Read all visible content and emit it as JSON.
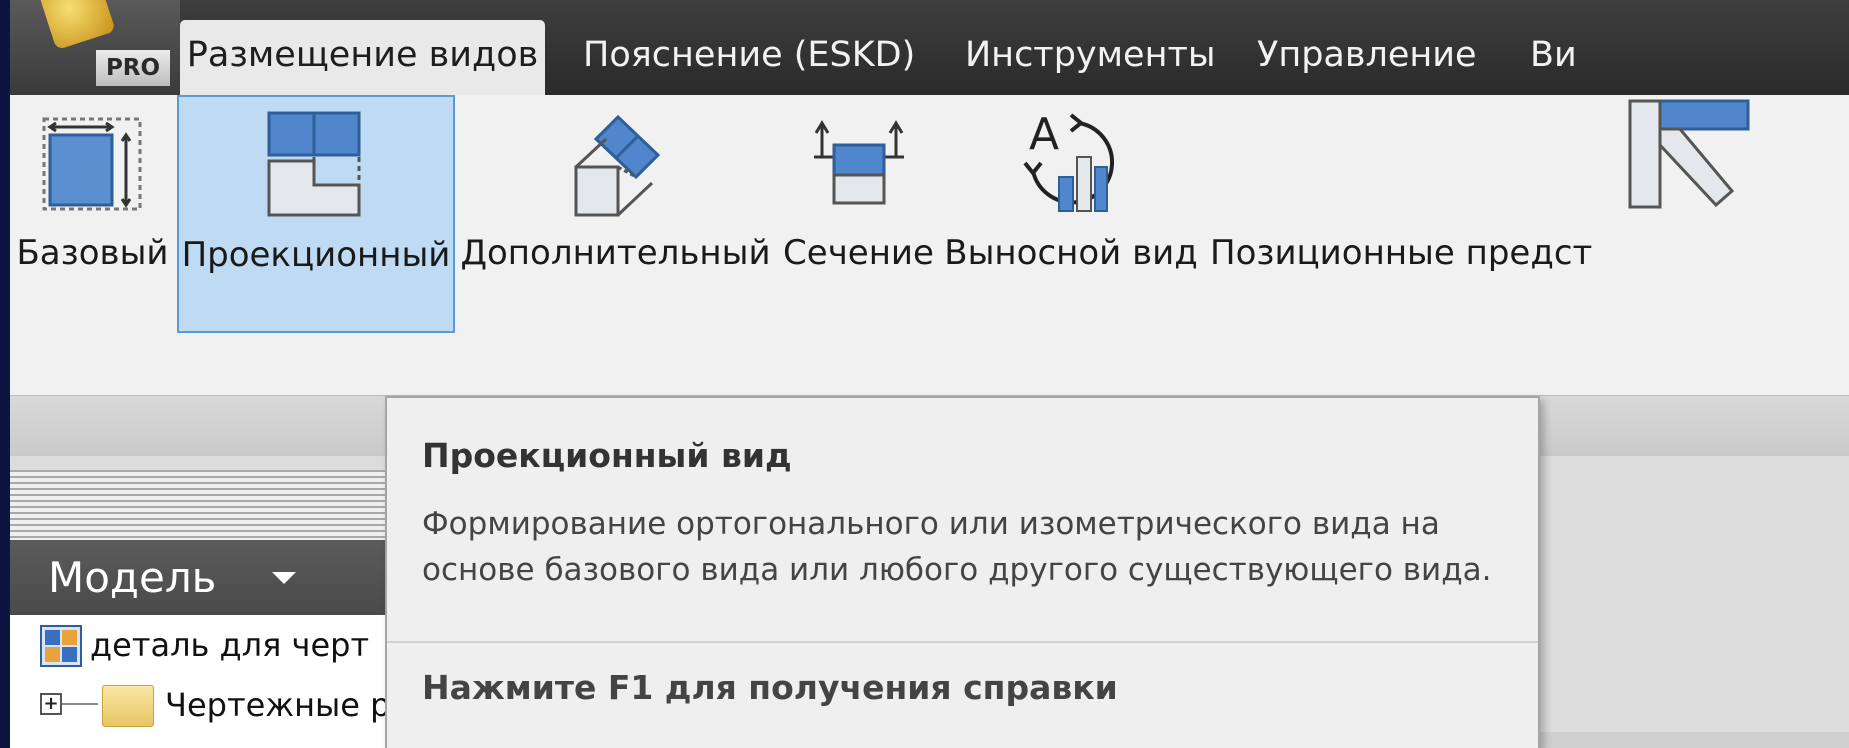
{
  "app_button": {
    "badge": "PRO"
  },
  "tabs": [
    {
      "label": "Размещение видов",
      "active": true
    },
    {
      "label": "Пояснение (ESKD)",
      "active": false
    },
    {
      "label": "Инструменты",
      "active": false
    },
    {
      "label": "Управление",
      "active": false
    },
    {
      "label": "Ви",
      "active": false
    }
  ],
  "ribbon": {
    "buttons": [
      {
        "label": "Базовый",
        "icon": "base-view-icon",
        "active": false
      },
      {
        "label": "Проекционный",
        "icon": "projected-view-icon",
        "active": true
      },
      {
        "label": "Дополнительный",
        "icon": "auxiliary-view-icon",
        "active": false
      },
      {
        "label": "Сечение",
        "icon": "section-view-icon",
        "active": false
      },
      {
        "label": "Выносной вид",
        "icon": "detail-view-icon",
        "active": false
      },
      {
        "label": "Позиционные предст",
        "icon": "positional-representations-icon",
        "active": false
      }
    ]
  },
  "model_panel": {
    "title": "Модель",
    "tree": [
      {
        "label": "деталь для черт",
        "icon": "drawing-document-icon"
      },
      {
        "label": "Чертежные р",
        "icon": "folder-icon",
        "expandable": true
      }
    ]
  },
  "tooltip": {
    "title": "Проекционный вид",
    "description_line1": "Формирование ортогонального или изометрического вида на",
    "description_line2": "основе базового вида или любого другого существующего вида.",
    "help": "Нажмите F1 для получения справки"
  },
  "colors": {
    "accent_blue": "#5a9bd5",
    "selected_bg": "#bfdbf4",
    "tab_bar": "#333333"
  }
}
